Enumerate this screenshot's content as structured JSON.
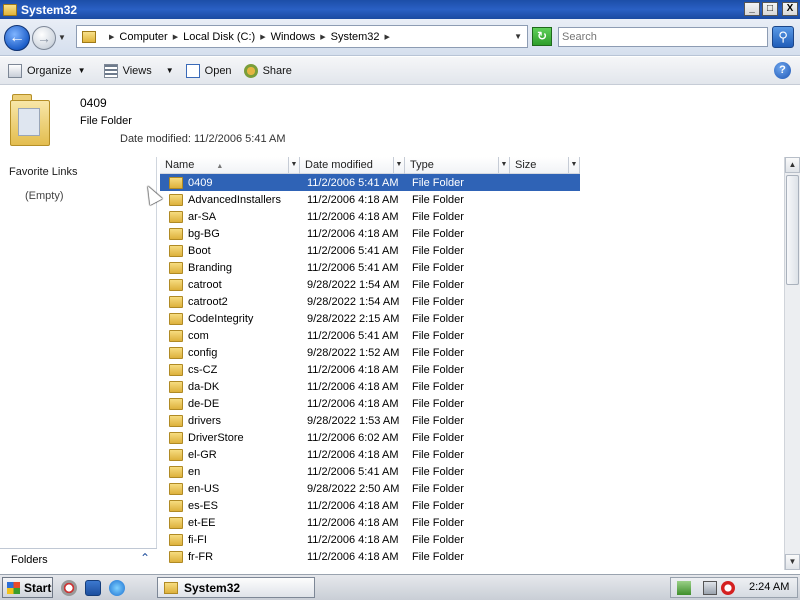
{
  "window": {
    "title": "System32"
  },
  "caption_buttons": {
    "minimize": "_",
    "maximize": "□",
    "close": "X"
  },
  "address": {
    "breadcrumbs": [
      "Computer",
      "Local Disk (C:)",
      "Windows",
      "System32"
    ],
    "search_placeholder": "Search"
  },
  "toolbar": {
    "organize": "Organize",
    "views": "Views",
    "open": "Open",
    "share": "Share"
  },
  "details": {
    "name": "0409",
    "type": "File Folder",
    "date_modified": "Date modified: 11/2/2006 5:41 AM"
  },
  "navpane": {
    "favorite_links": "Favorite Links",
    "empty": "(Empty)",
    "folders": "Folders"
  },
  "columns": {
    "name": "Name",
    "date_modified": "Date modified",
    "type": "Type",
    "size": "Size"
  },
  "rows": [
    {
      "name": "0409",
      "date": "11/2/2006 5:41 AM",
      "type": "File Folder"
    },
    {
      "name": "AdvancedInstallers",
      "date": "11/2/2006 4:18 AM",
      "type": "File Folder"
    },
    {
      "name": "ar-SA",
      "date": "11/2/2006 4:18 AM",
      "type": "File Folder"
    },
    {
      "name": "bg-BG",
      "date": "11/2/2006 4:18 AM",
      "type": "File Folder"
    },
    {
      "name": "Boot",
      "date": "11/2/2006 5:41 AM",
      "type": "File Folder"
    },
    {
      "name": "Branding",
      "date": "11/2/2006 5:41 AM",
      "type": "File Folder"
    },
    {
      "name": "catroot",
      "date": "9/28/2022 1:54 AM",
      "type": "File Folder"
    },
    {
      "name": "catroot2",
      "date": "9/28/2022 1:54 AM",
      "type": "File Folder"
    },
    {
      "name": "CodeIntegrity",
      "date": "9/28/2022 2:15 AM",
      "type": "File Folder"
    },
    {
      "name": "com",
      "date": "11/2/2006 5:41 AM",
      "type": "File Folder"
    },
    {
      "name": "config",
      "date": "9/28/2022 1:52 AM",
      "type": "File Folder"
    },
    {
      "name": "cs-CZ",
      "date": "11/2/2006 4:18 AM",
      "type": "File Folder"
    },
    {
      "name": "da-DK",
      "date": "11/2/2006 4:18 AM",
      "type": "File Folder"
    },
    {
      "name": "de-DE",
      "date": "11/2/2006 4:18 AM",
      "type": "File Folder"
    },
    {
      "name": "drivers",
      "date": "9/28/2022 1:53 AM",
      "type": "File Folder"
    },
    {
      "name": "DriverStore",
      "date": "11/2/2006 6:02 AM",
      "type": "File Folder"
    },
    {
      "name": "el-GR",
      "date": "11/2/2006 4:18 AM",
      "type": "File Folder"
    },
    {
      "name": "en",
      "date": "11/2/2006 5:41 AM",
      "type": "File Folder"
    },
    {
      "name": "en-US",
      "date": "9/28/2022 2:50 AM",
      "type": "File Folder"
    },
    {
      "name": "es-ES",
      "date": "11/2/2006 4:18 AM",
      "type": "File Folder"
    },
    {
      "name": "et-EE",
      "date": "11/2/2006 4:18 AM",
      "type": "File Folder"
    },
    {
      "name": "fi-FI",
      "date": "11/2/2006 4:18 AM",
      "type": "File Folder"
    },
    {
      "name": "fr-FR",
      "date": "11/2/2006 4:18 AM",
      "type": "File Folder"
    }
  ],
  "selected_row": 0,
  "taskbar": {
    "start": "Start",
    "task": "System32",
    "clock": "2:24 AM"
  },
  "colors": {
    "selection": "#2f63b6",
    "titlebar": "#1c4ea8"
  }
}
